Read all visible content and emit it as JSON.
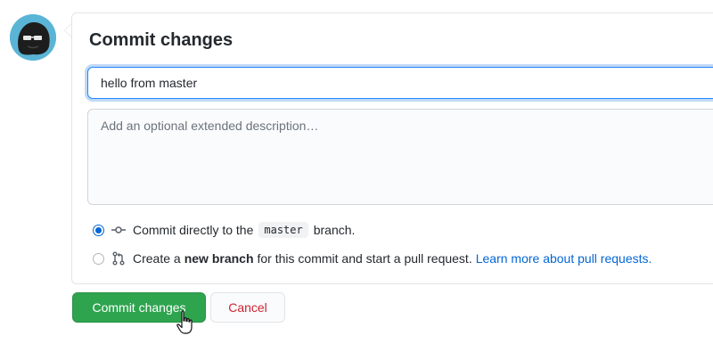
{
  "commit_form": {
    "title": "Commit changes",
    "summary_value": "hello from master",
    "description_placeholder": "Add an optional extended description…",
    "options": {
      "direct": {
        "prefix": "Commit directly to the",
        "branch": "master",
        "suffix": "branch.",
        "selected": true,
        "icon": "git-commit-icon"
      },
      "new_branch": {
        "prefix": "Create a",
        "bold": "new branch",
        "suffix": "for this commit and start a pull request.",
        "link": "Learn more about pull requests.",
        "selected": false,
        "icon": "git-pull-request-icon"
      }
    }
  },
  "buttons": {
    "commit_label": "Commit changes",
    "cancel_label": "Cancel"
  },
  "colors": {
    "primary_green": "#2ea44f",
    "link_blue": "#0366d6",
    "cancel_red": "#cb2431",
    "focus_blue": "#2188ff"
  }
}
